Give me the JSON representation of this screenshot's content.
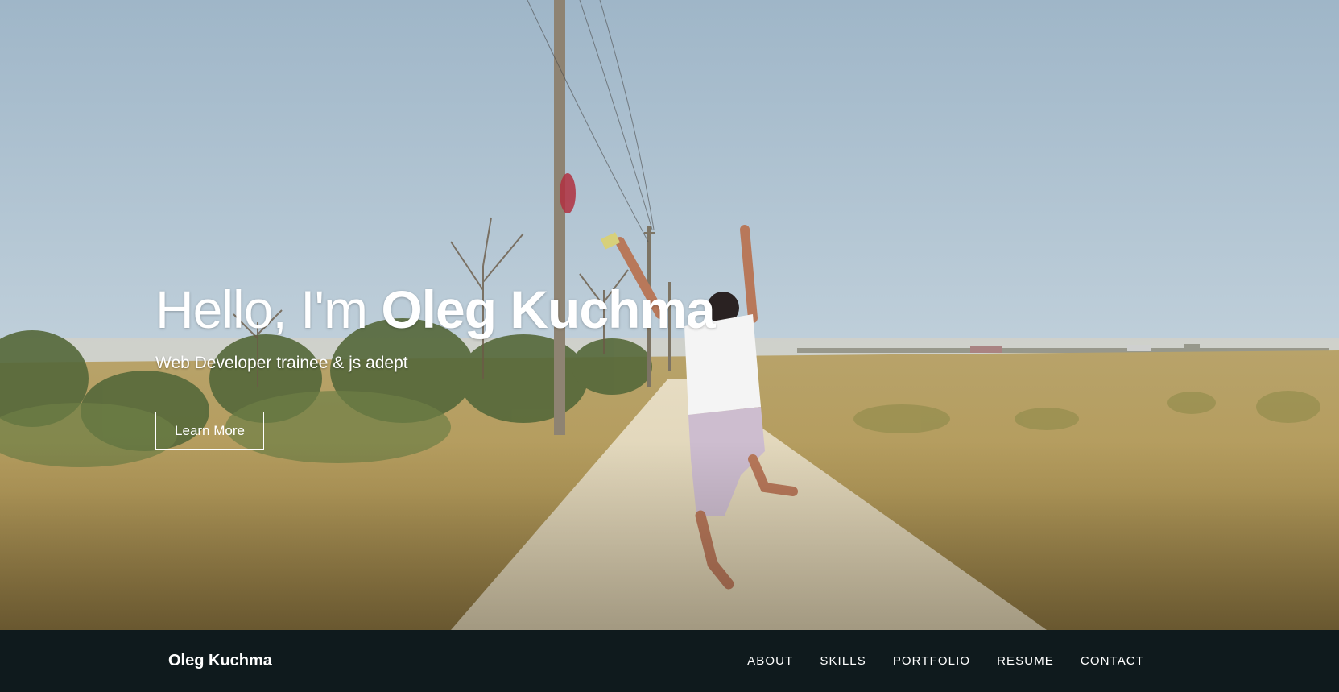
{
  "hero": {
    "greeting": "Hello, I'm ",
    "name": "Oleg Kuchma",
    "subtitle": "Web Developer trainee & js adept",
    "cta_label": "Learn More"
  },
  "navbar": {
    "brand": "Oleg Kuchma",
    "items": [
      {
        "label": "ABOUT"
      },
      {
        "label": "SKILLS"
      },
      {
        "label": "PORTFOLIO"
      },
      {
        "label": "RESUME"
      },
      {
        "label": "CONTACT"
      }
    ]
  },
  "colors": {
    "navbar_bg": "#0f1a1d",
    "text": "#ffffff"
  }
}
